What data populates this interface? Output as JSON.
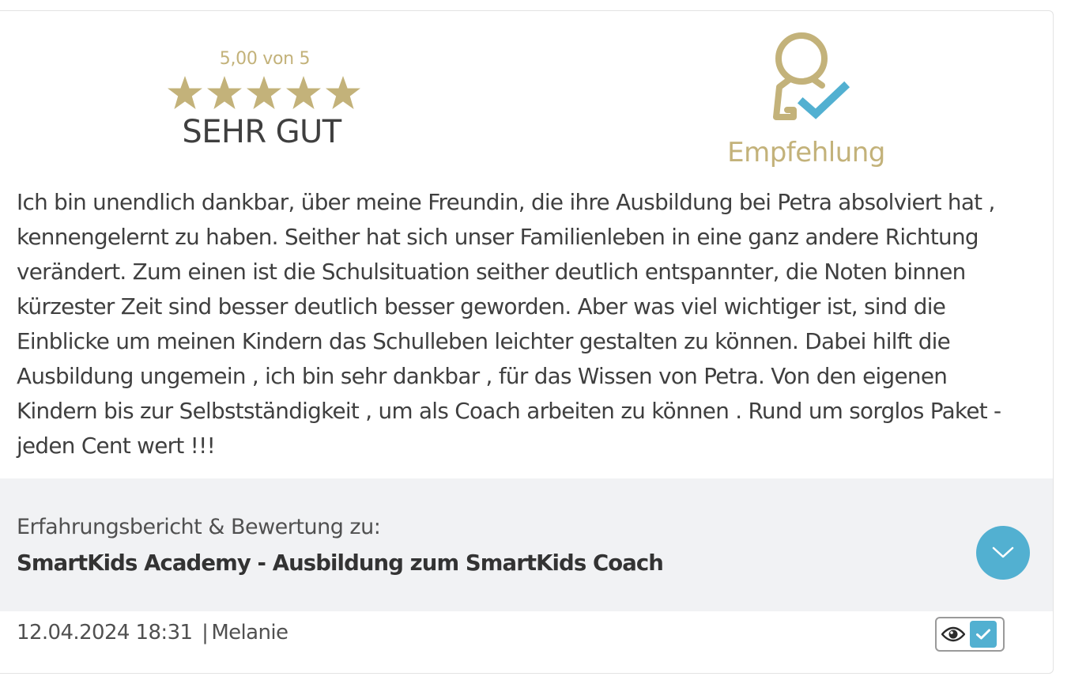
{
  "rating": {
    "score_text": "5,00 von 5",
    "stars": 5,
    "label": "SEHR GUT",
    "star_color": "#c3b27a"
  },
  "recommendation": {
    "label": "Empfehlung",
    "icon": "user-check-icon",
    "color": "#c3b27a",
    "check_color": "#52b0d1"
  },
  "review": {
    "text": "Ich bin unendlich dankbar, über meine Freundin, die ihre Ausbildung bei Petra absolviert hat , kennengelernt zu haben. Seither hat sich unser Familienleben in eine ganz andere Richtung verändert. Zum einen ist die Schulsituation seither deutlich entspannter, die Noten binnen kürzester Zeit sind besser deutlich besser geworden. Aber was viel wichtiger ist, sind die Einblicke um meinen Kindern das Schulleben leichter gestalten zu können. Dabei hilft die Ausbildung ungemein , ich bin sehr dankbar , für das Wissen von Petra. Von den eigenen Kindern bis zur Selbstständigkeit , um als Coach arbeiten zu können . Rund um sorglos Paket - jeden Cent wert !!!"
  },
  "product": {
    "caption": "Erfahrungsbericht & Bewertung zu:",
    "name": "SmartKids Academy - Ausbildung zum SmartKids Coach",
    "expand_icon": "chevron-down-icon",
    "accent": "#52b0d1"
  },
  "footer": {
    "date": "12.04.2024 18:31",
    "separator": "|",
    "author": "Melanie",
    "badge_icons": [
      "eye-icon",
      "check-icon"
    ]
  }
}
